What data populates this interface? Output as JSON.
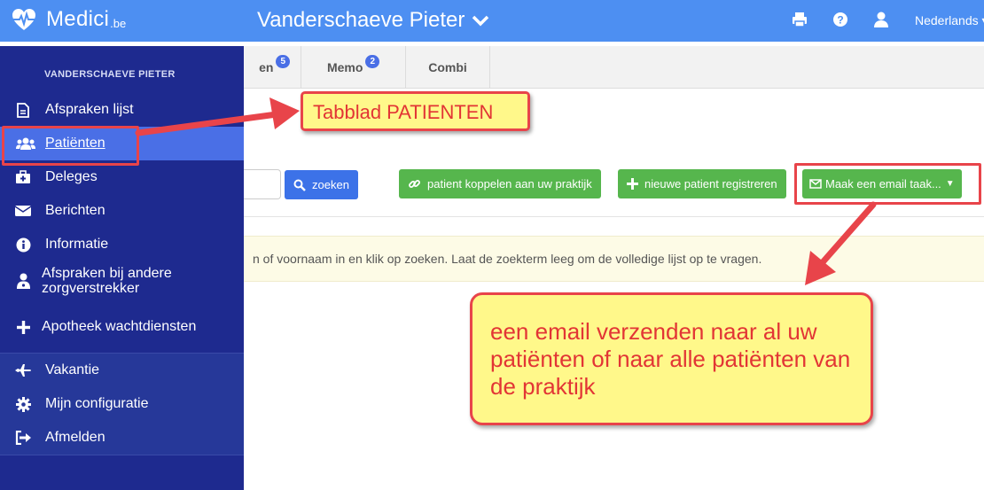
{
  "topbar": {
    "brand": "Medici",
    "brand_tld": ".be",
    "user_title": "Vanderschaeve Pieter",
    "language": "Nederlands",
    "icons": [
      "heartbeat-icon",
      "chevron-down-icon",
      "print-icon",
      "help-icon",
      "user-icon"
    ]
  },
  "sidebar": {
    "heading": "VANDERSCHAEVE PIETER",
    "items": [
      {
        "label": "Afspraken lijst",
        "icon": "file-icon"
      },
      {
        "label": "Patiënten",
        "icon": "users-icon",
        "active": true
      },
      {
        "label": "Deleges",
        "icon": "medkit-icon"
      },
      {
        "label": "Berichten",
        "icon": "envelope-icon"
      },
      {
        "label": "Informatie",
        "icon": "info-icon"
      },
      {
        "label_line1": "Afspraken bij andere",
        "label_line2": "zorgverstrekker",
        "icon": "user-doctor-icon"
      },
      {
        "label": "Apotheek wachtdiensten",
        "icon": "plus-icon"
      },
      {
        "label": "Vakantie",
        "icon": "plane-icon"
      },
      {
        "label": "Mijn configuratie",
        "icon": "gear-icon"
      },
      {
        "label": "Afmelden",
        "icon": "sign-out-icon"
      }
    ]
  },
  "tabs": [
    {
      "label": "en",
      "badge": "5"
    },
    {
      "label": "Memo",
      "badge": "2"
    },
    {
      "label": "Combi"
    }
  ],
  "toolbar": {
    "search_label": "zoeken",
    "link_patient_label": "patient koppelen aan uw praktijk",
    "new_patient_label": "nieuwe patient registreren",
    "email_task_label": "Maak een email taak..."
  },
  "info_text": "n of voornaam in en klik op zoeken. Laat de zoekterm leeg om de volledige lijst op te vragen.",
  "annotations": {
    "callout_tab": "Tabblad PATIENTEN",
    "callout_email": "een email verzenden naar al uw patiënten of naar alle patiënten van de praktijk"
  },
  "colors": {
    "topbar": "#4d8ff2",
    "sidebar": "#1e2a8f",
    "sidebar_active": "#4a6fe6",
    "button_blue": "#3c72e8",
    "button_green": "#56b64d",
    "annotation_red": "#e8444a",
    "annotation_yellow": "#fff88a"
  }
}
